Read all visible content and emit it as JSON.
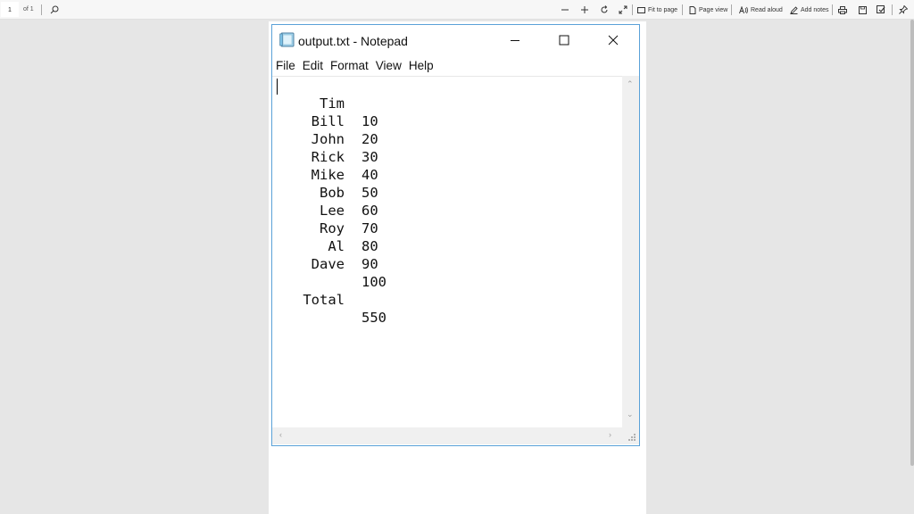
{
  "viewer": {
    "page_number": "1",
    "page_of": "of 1",
    "buttons": {
      "fit_to_page": "Fit to page",
      "page_view": "Page view",
      "read_aloud": "Read aloud",
      "add_notes": "Add notes"
    }
  },
  "notepad": {
    "title": "output.txt - Notepad",
    "menu": [
      "File",
      "Edit",
      "Format",
      "View",
      "Help"
    ],
    "rows": [
      {
        "name": "Tim",
        "value": "10"
      },
      {
        "name": "Bill",
        "value": "20"
      },
      {
        "name": "John",
        "value": "30"
      },
      {
        "name": "Rick",
        "value": "40"
      },
      {
        "name": "Mike",
        "value": "50"
      },
      {
        "name": "Bob",
        "value": "60"
      },
      {
        "name": "Lee",
        "value": "70"
      },
      {
        "name": "Roy",
        "value": "80"
      },
      {
        "name": "Al",
        "value": "90"
      },
      {
        "name": "Dave",
        "value": "100"
      }
    ],
    "total": {
      "name": "Total",
      "value": "550"
    }
  },
  "colors": {
    "window_border": "#5aa1d8",
    "viewer_background": "#e6e6e6"
  }
}
